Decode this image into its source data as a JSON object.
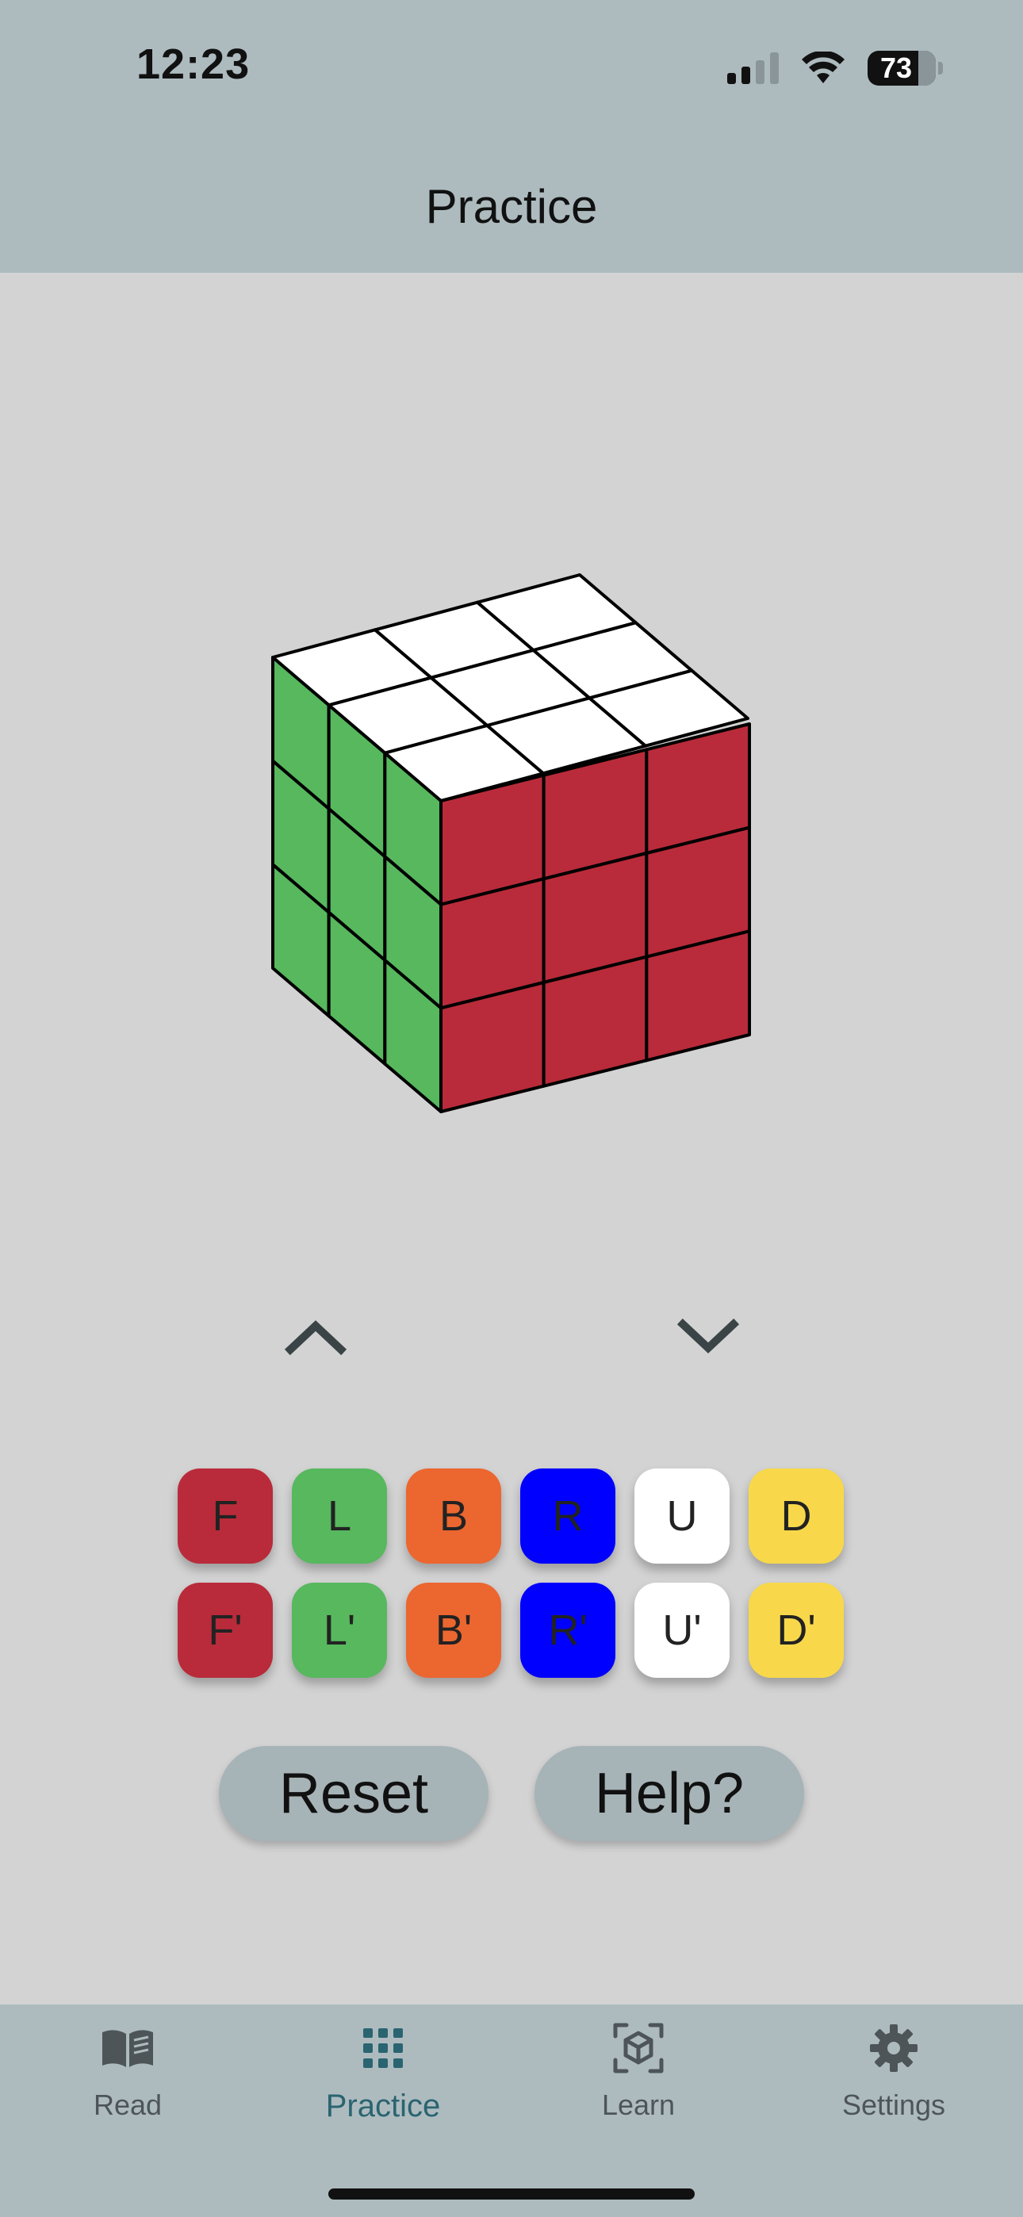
{
  "status_bar": {
    "time": "12:23",
    "battery": "73",
    "icons": [
      "signal-icon",
      "wifi-icon",
      "battery-icon"
    ]
  },
  "header": {
    "title": "Practice"
  },
  "cube": {
    "faces": {
      "top": "white",
      "front": "red",
      "left": "green"
    },
    "colors": {
      "white": "#ffffff",
      "red": "#b92b3a",
      "green": "#57b85e",
      "edge": "#000000"
    }
  },
  "controls": {
    "up_arrow": "chevron-up-icon",
    "down_arrow": "chevron-down-icon"
  },
  "moves": {
    "row1": [
      {
        "label": "F",
        "color": "#b92b3a"
      },
      {
        "label": "L",
        "color": "#57b85e"
      },
      {
        "label": "B",
        "color": "#ec6630"
      },
      {
        "label": "R",
        "color": "#0000ff"
      },
      {
        "label": "U",
        "color": "#ffffff"
      },
      {
        "label": "D",
        "color": "#f8d84a"
      }
    ],
    "row2": [
      {
        "label": "F'",
        "color": "#b92b3a"
      },
      {
        "label": "L'",
        "color": "#57b85e"
      },
      {
        "label": "B'",
        "color": "#ec6630"
      },
      {
        "label": "R'",
        "color": "#0000ff"
      },
      {
        "label": "U'",
        "color": "#ffffff"
      },
      {
        "label": "D'",
        "color": "#f8d84a"
      }
    ]
  },
  "actions": {
    "reset": "Reset",
    "help": "Help?"
  },
  "tabbar": {
    "tabs": [
      {
        "label": "Read",
        "icon": "book-icon",
        "active": false
      },
      {
        "label": "Practice",
        "icon": "grid-icon",
        "active": true
      },
      {
        "label": "Learn",
        "icon": "cube-scan-icon",
        "active": false
      },
      {
        "label": "Settings",
        "icon": "gear-icon",
        "active": false
      }
    ]
  }
}
